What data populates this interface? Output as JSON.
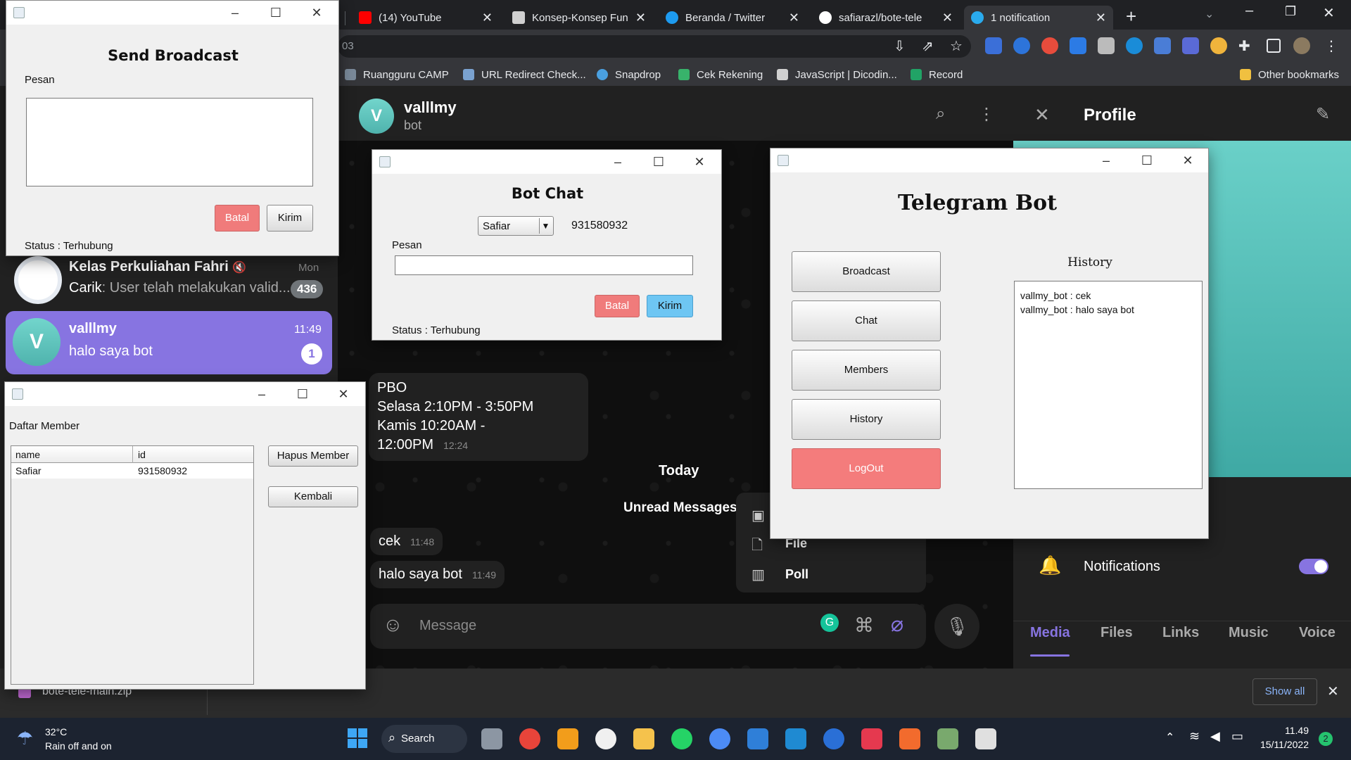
{
  "browser": {
    "tabs": [
      {
        "title": "(14) YouTube",
        "favicon": "youtube-icon",
        "color": "#ff0000"
      },
      {
        "title": "Konsep-Konsep Fun",
        "favicon": "dicoding-icon",
        "color": "#e0e0e0"
      },
      {
        "title": "Beranda / Twitter",
        "favicon": "twitter-icon",
        "color": "#1d9bf0"
      },
      {
        "title": "safiarazl/bote-tele",
        "favicon": "github-icon",
        "color": "#ffffff"
      },
      {
        "title": "1 notification",
        "favicon": "telegram-icon",
        "color": "#2aabee"
      }
    ],
    "url_fragment": "03",
    "bookmarks": [
      "Ruangguru CAMP",
      "URL Redirect Check...",
      "Snapdrop",
      "Cek Rekening",
      "JavaScript | Dicodin...",
      "Record",
      "Other bookmarks"
    ]
  },
  "telegram": {
    "chat_header": {
      "name": "valllmy",
      "status": "bot",
      "initial": "V"
    },
    "chat_list": [
      {
        "name": "Kelas Perkuliahan Fahri",
        "sender": "Carik",
        "preview": ": User telah melakukan valid...",
        "time": "Mon",
        "badge": "436"
      },
      {
        "name": "valllmy",
        "preview": "halo saya bot",
        "time": "11:49",
        "badge": "1",
        "initial": "V"
      }
    ],
    "messages": {
      "schedule": {
        "line1": "PBO",
        "line2": "Selasa 2:10PM - 3:50PM",
        "line3": "Kamis 10:20AM - 12:00PM",
        "time": "12:24"
      },
      "today": "Today",
      "unread": "Unread Messages",
      "msg1": {
        "text": "cek",
        "time": "11:48"
      },
      "msg2": {
        "text": "halo saya bot",
        "time": "11:49"
      }
    },
    "attach_menu": [
      "File",
      "Poll"
    ],
    "composer_placeholder": "Message",
    "profile": {
      "title": "Profile",
      "notifications": "Notifications",
      "tabs": [
        "Media",
        "Files",
        "Links",
        "Music",
        "Voice"
      ]
    }
  },
  "broadcast_window": {
    "title": "Send Broadcast",
    "pesan_label": "Pesan",
    "batal": "Batal",
    "kirim": "Kirim",
    "status": "Status : Terhubung"
  },
  "botchat_window": {
    "title": "Bot Chat",
    "selected_user": "Safiar",
    "user_id": "931580932",
    "pesan_label": "Pesan",
    "batal": "Batal",
    "kirim": "Kirim",
    "status": "Status : Terhubung"
  },
  "telegrambot_window": {
    "title": "Telegram Bot",
    "buttons": [
      "Broadcast",
      "Chat",
      "Members",
      "History",
      "LogOut"
    ],
    "history_label": "History",
    "history": [
      "vallmy_bot : cek",
      "vallmy_bot : halo saya bot"
    ]
  },
  "member_window": {
    "title": "Daftar Member",
    "columns": [
      "name",
      "id"
    ],
    "rows": [
      [
        "Safiar",
        "931580932"
      ]
    ],
    "hapus": "Hapus Member",
    "kembali": "Kembali"
  },
  "downloads": {
    "file": "bote-tele-main.zip",
    "show_all": "Show all"
  },
  "taskbar": {
    "weather_temp": "32°C",
    "weather_desc": "Rain off and on",
    "search": "Search",
    "time": "11.49",
    "date": "15/11/2022",
    "notif_count": "2"
  },
  "colors": {
    "accent_purple": "#8774e1",
    "batal_red": "#f07b7b",
    "kirim_blue": "#6ec6f3",
    "logout_red": "#f47c7c"
  }
}
